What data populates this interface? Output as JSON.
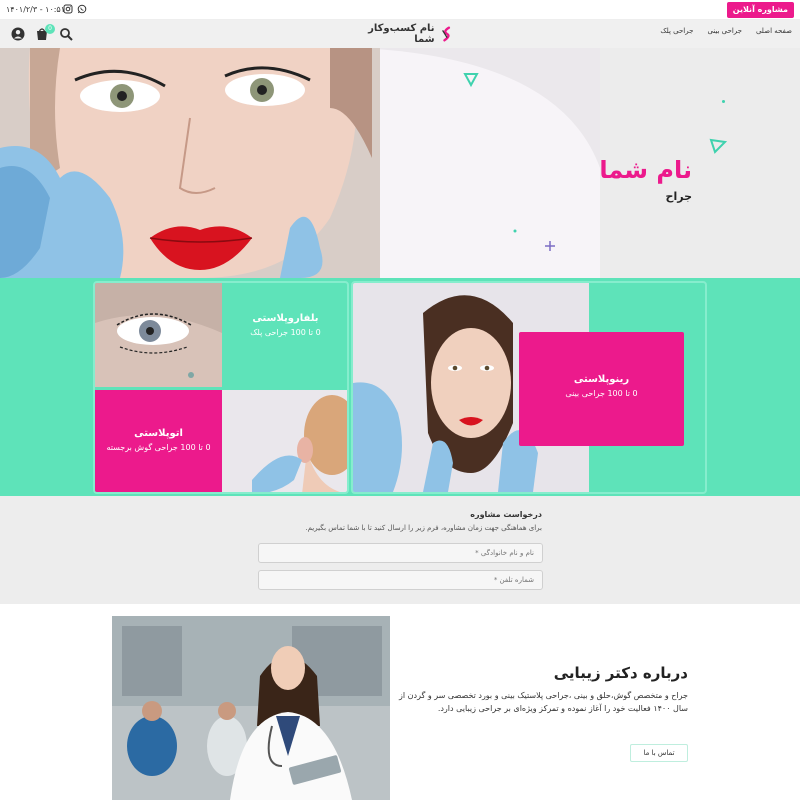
{
  "topbar": {
    "consult_button": "مشاوره آنلاین",
    "datetime": "۱۴۰۱/۲/۳ - ۱۰:۵۱",
    "icons": [
      "whatsapp-icon",
      "instagram-icon"
    ]
  },
  "header": {
    "nav": [
      "صفحه اصلی",
      "جراحی بینی",
      "جراحی پلک"
    ],
    "logo_text": "نام کسب‌وکار شما",
    "cart_count": "0",
    "icons": [
      "user-icon",
      "cart-icon",
      "search-icon"
    ]
  },
  "hero": {
    "title": "نام شما",
    "subtitle": "جراح"
  },
  "services": {
    "cards": [
      {
        "title": "بلفاروپلاستی",
        "desc": "0 تا 100 جراحی پلک"
      },
      {
        "title": "اتوپلاستی",
        "desc": "0 تا 100 جراحی گوش برجسته"
      },
      {
        "title": "رینوپلاستی",
        "desc": "0 تا 100 جراحی بینی"
      }
    ]
  },
  "consult": {
    "title": "درخواست مشاوره",
    "subtitle": "برای هماهنگی جهت زمان مشاوره، فرم زیر را ارسال کنید تا با شما تماس بگیریم.",
    "name_placeholder": "نام و نام خانوادگی *",
    "phone_placeholder": "شماره تلفن *"
  },
  "about": {
    "title": "درباره دکتر زیبایی",
    "text": "جراح و متخصص گوش،حلق و بینی ،جراحی پلاستیک بینی و بورد تخصصی سر و گردن از سال ۱۴۰۰ فعالیت خود را آغاز نموده و تمرکز ویژه‌ای بر جراحی زیبایی دارد.",
    "contact_button": "تماس با ما"
  },
  "colors": {
    "accent_pink": "#ec1a8c",
    "accent_mint": "#5ee3b9"
  }
}
